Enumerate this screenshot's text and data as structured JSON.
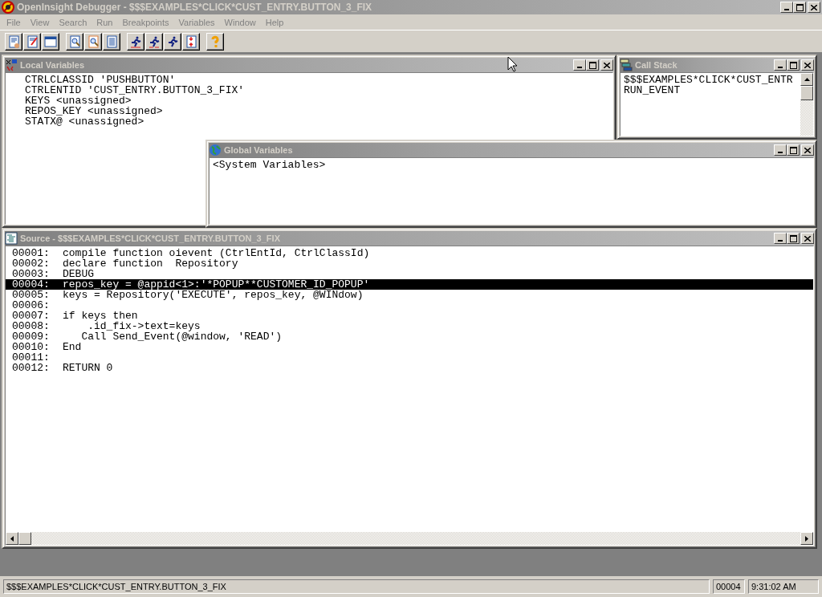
{
  "window": {
    "title": "OpenInsight Debugger - $$$EXAMPLES*CLICK*CUST_ENTRY.BUTTON_3_FIX"
  },
  "menu": [
    {
      "label": "File",
      "disabled": true
    },
    {
      "label": "View",
      "disabled": true
    },
    {
      "label": "Search",
      "disabled": true
    },
    {
      "label": "Run",
      "disabled": true
    },
    {
      "label": "Breakpoints",
      "disabled": true
    },
    {
      "label": "Variables",
      "disabled": true
    },
    {
      "label": "Window",
      "disabled": true
    },
    {
      "label": "Help",
      "disabled": true
    }
  ],
  "toolbar": [
    [
      {
        "kind": "open"
      },
      {
        "kind": "edit"
      },
      {
        "kind": "window"
      }
    ],
    [
      {
        "kind": "find"
      },
      {
        "kind": "find-next"
      },
      {
        "kind": "list"
      }
    ],
    [
      {
        "kind": "run"
      },
      {
        "kind": "step"
      },
      {
        "kind": "go"
      },
      {
        "kind": "breakpoint"
      }
    ],
    [
      {
        "kind": "help"
      }
    ]
  ],
  "local_variables": {
    "title": "Local Variables",
    "lines": [
      "CTRLCLASSID 'PUSHBUTTON'",
      "CTRLENTID 'CUST_ENTRY.BUTTON_3_FIX'",
      "KEYS <unassigned>",
      "REPOS_KEY <unassigned>",
      "STATX@ <unassigned>"
    ]
  },
  "call_stack": {
    "title": "Call Stack",
    "lines": [
      "$$$EXAMPLES*CLICK*CUST_ENTR",
      "RUN_EVENT"
    ]
  },
  "global_variables": {
    "title": "Global Variables",
    "lines": [
      "<System Variables>"
    ]
  },
  "source": {
    "title": "Source - $$$EXAMPLES*CLICK*CUST_ENTRY.BUTTON_3_FIX",
    "lines": [
      {
        "number": "00001:",
        "code": "compile function oievent (CtrlEntId, CtrlClassId)",
        "selected": false
      },
      {
        "number": "00002:",
        "code": "declare function  Repository",
        "selected": false
      },
      {
        "number": "00003:",
        "code": "DEBUG",
        "selected": false
      },
      {
        "number": "00004:",
        "code": "repos_key = @appid<1>:'*POPUP**CUSTOMER_ID_POPUP'",
        "selected": true
      },
      {
        "number": "00005:",
        "code": "keys = Repository('EXECUTE', repos_key, @WINdow)",
        "selected": false
      },
      {
        "number": "00006:",
        "selected": false
      },
      {
        "number": "00007:",
        "code": "if keys then",
        "selected": false
      },
      {
        "number": "00008:",
        "code": "    .id_fix->text=keys",
        "selected": false
      },
      {
        "number": "00009:",
        "code": "   Call Send_Event(@window, 'READ')",
        "selected": false
      },
      {
        "number": "00010:",
        "code": "End",
        "selected": false
      },
      {
        "number": "00011:",
        "selected": false
      },
      {
        "number": "00012:",
        "code": "RETURN 0",
        "selected": false
      }
    ]
  },
  "status_bar": {
    "path": "$$$EXAMPLES*CLICK*CUST_ENTRY.BUTTON_3_FIX",
    "line": "00004",
    "time": "9:31:02 AM"
  }
}
